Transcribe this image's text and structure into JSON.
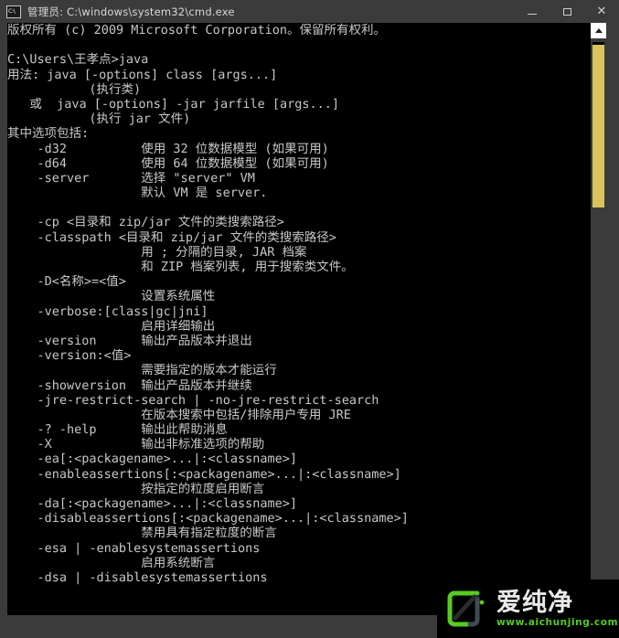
{
  "window": {
    "title": "管理员: C:\\windows\\system32\\cmd.exe",
    "icon_name": "cmd-icon",
    "icon_glyph": "C:\\",
    "controls": {
      "minimize_label": "–",
      "maximize_label": "□",
      "close_label": "✕"
    }
  },
  "scrollbar": {
    "up_arrow_name": "scroll-up-arrow",
    "down_arrow_name": "scroll-down-arrow",
    "thumb_color": "#d8c45a",
    "track_color": "#3b3b3b"
  },
  "console": {
    "foreground_color": "#c8c8c8",
    "background_color": "#000000",
    "lines": [
      "版权所有 (c) 2009 Microsoft Corporation。保留所有权利。",
      "",
      "C:\\Users\\王孝点>java",
      "用法: java [-options] class [args...]",
      "           (执行类)",
      "   或  java [-options] -jar jarfile [args...]",
      "           (执行 jar 文件)",
      "其中选项包括:",
      "    -d32          使用 32 位数据模型 (如果可用)",
      "    -d64          使用 64 位数据模型 (如果可用)",
      "    -server       选择 \"server\" VM",
      "                  默认 VM 是 server.",
      "",
      "    -cp <目录和 zip/jar 文件的类搜索路径>",
      "    -classpath <目录和 zip/jar 文件的类搜索路径>",
      "                  用 ; 分隔的目录, JAR 档案",
      "                  和 ZIP 档案列表, 用于搜索类文件。",
      "    -D<名称>=<值>",
      "                  设置系统属性",
      "    -verbose:[class|gc|jni]",
      "                  启用详细输出",
      "    -version      输出产品版本并退出",
      "    -version:<值>",
      "                  需要指定的版本才能运行",
      "    -showversion  输出产品版本并继续",
      "    -jre-restrict-search | -no-jre-restrict-search",
      "                  在版本搜索中包括/排除用户专用 JRE",
      "    -? -help      输出此帮助消息",
      "    -X            输出非标准选项的帮助",
      "    -ea[:<packagename>...|:<classname>]",
      "    -enableassertions[:<packagename>...|:<classname>]",
      "                  按指定的粒度启用断言",
      "    -da[:<packagename>...|:<classname>]",
      "    -disableassertions[:<packagename>...|:<classname>]",
      "                  禁用具有指定粒度的断言",
      "    -esa | -enablesystemassertions",
      "                  启用系统断言",
      "    -dsa | -disablesystemassertions"
    ]
  },
  "watermark": {
    "brand": "爱纯净",
    "url": "www.aichunjing.com",
    "accent_color": "#55cc22",
    "logo_name": "aichunjing-logo-icon"
  }
}
